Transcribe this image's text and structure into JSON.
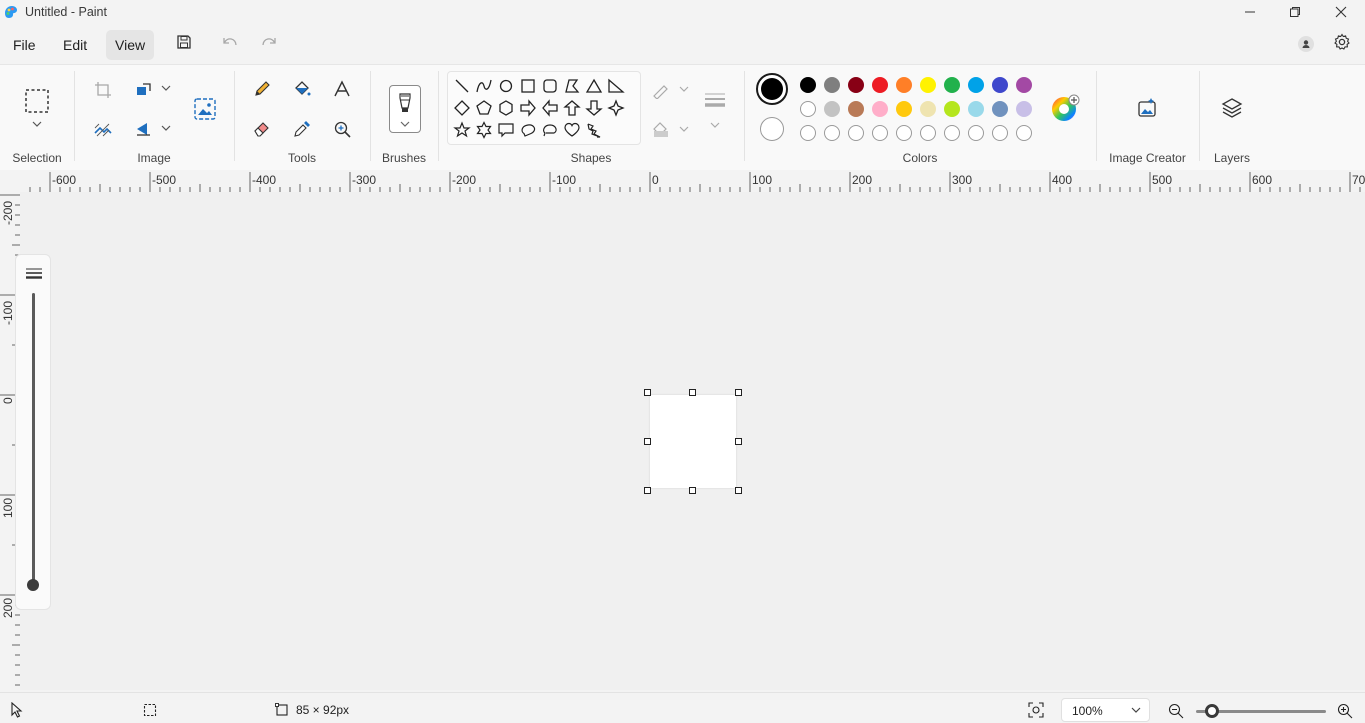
{
  "window": {
    "title": "Untitled - Paint"
  },
  "menu": {
    "file": "File",
    "edit": "Edit",
    "view": "View"
  },
  "ribbon": {
    "groups": {
      "selection": "Selection",
      "image": "Image",
      "tools": "Tools",
      "brushes": "Brushes",
      "shapes": "Shapes",
      "colors": "Colors",
      "image_creator": "Image Creator",
      "layers": "Layers"
    }
  },
  "colors": {
    "primary": "#000000",
    "secondary": "#ffffff",
    "palette_row1": [
      "#000000",
      "#7f7f7f",
      "#880015",
      "#ed1c24",
      "#ff7f27",
      "#fff200",
      "#22b14c",
      "#00a2e8",
      "#3f48cc",
      "#a349a4"
    ],
    "palette_row2": [
      "#ffffff",
      "#c3c3c3",
      "#b97a57",
      "#ffaec9",
      "#ffc90e",
      "#efe4b0",
      "#b5e61d",
      "#99d9ea",
      "#7092be",
      "#c8bfe7"
    ],
    "palette_row3_empty": 10
  },
  "rulers": {
    "horizontal": [
      "-600",
      "-500",
      "-400",
      "-300",
      "-200",
      "-100",
      "0",
      "100",
      "200",
      "300",
      "400",
      "500",
      "600",
      "70"
    ],
    "vertical": [
      "-200",
      "-100",
      "0",
      "100",
      "200"
    ]
  },
  "status": {
    "canvas_size": "85 × 92px",
    "zoom": "100%",
    "zoom_slider_fraction": 0.12
  }
}
